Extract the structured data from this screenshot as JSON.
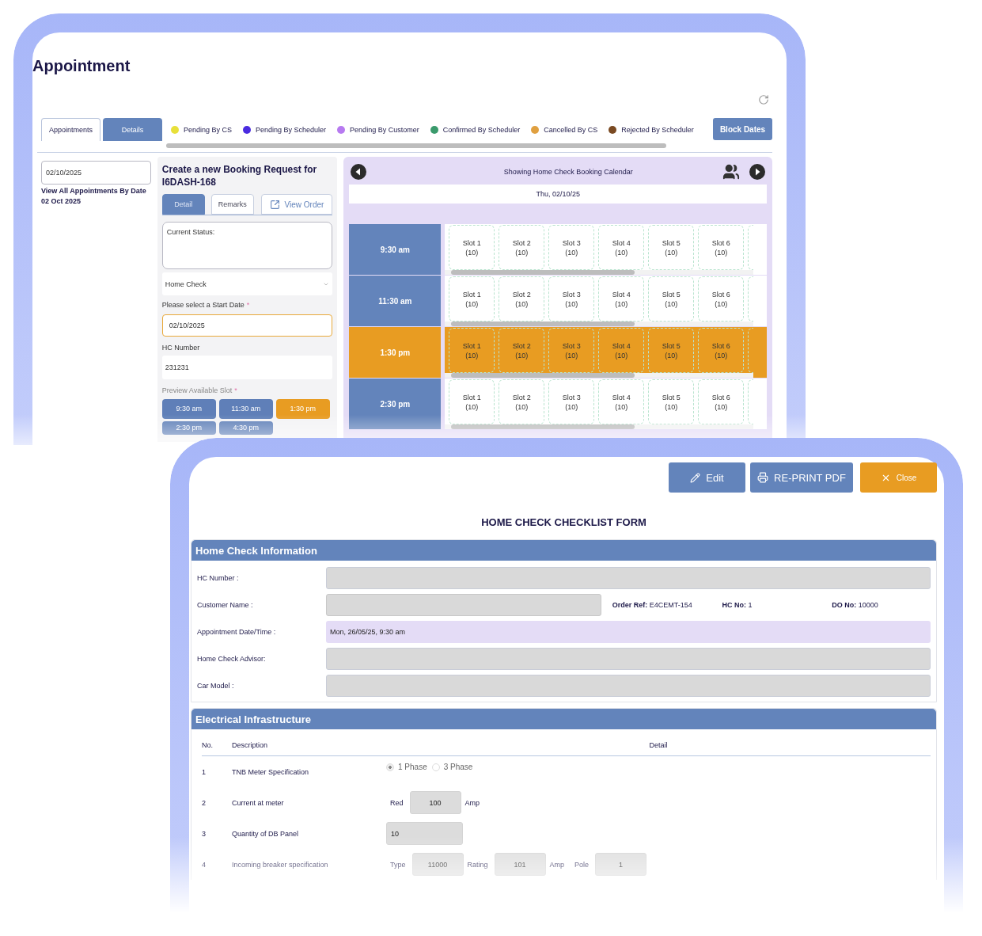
{
  "appointments_window": {
    "title": "Appointment",
    "tabs": [
      {
        "label": "Appointments",
        "selected": true
      },
      {
        "label": "Details",
        "selected": false
      }
    ],
    "legend": [
      {
        "label": "Pending By CS",
        "color": "#e8e03a"
      },
      {
        "label": "Pending By Scheduler",
        "color": "#4a2be0"
      },
      {
        "label": "Pending By Customer",
        "color": "#b77af0"
      },
      {
        "label": "Confirmed By Scheduler",
        "color": "#3a9a6c"
      },
      {
        "label": "Cancelled By CS",
        "color": "#e0a040"
      },
      {
        "label": "Rejected By Scheduler",
        "color": "#7a4a22"
      }
    ],
    "block_button": "Block Dates",
    "date_filter": {
      "value": "02/10/2025",
      "link": "View All Appointments By Date",
      "date": "02 Oct 2025"
    },
    "booking": {
      "heading": "Create a new Booking Request for I6DASH-168",
      "tabs": [
        {
          "label": "Detail",
          "selected": true
        },
        {
          "label": "Remarks",
          "selected": false
        }
      ],
      "view_order": "View Order",
      "status_label": "Current Status:",
      "service": "Home Check",
      "start_date_label": "Please select a Start Date",
      "start_date_mark": "*",
      "start_date": "02/10/2025",
      "hc_label": "HC Number",
      "hc_value": "231231",
      "slot_label": "Preview Available Slot",
      "slot_mark": "*",
      "slots": [
        {
          "label": "9:30 am",
          "selected": false
        },
        {
          "label": "11:30 am",
          "selected": false
        },
        {
          "label": "1:30 pm",
          "selected": true
        },
        {
          "label": "2:30 pm",
          "selected": false
        },
        {
          "label": "4:30 pm",
          "selected": false
        }
      ]
    },
    "calendar": {
      "title": "Showing Home Check Booking Calendar",
      "date": "Thu, 02/10/25",
      "rows": [
        {
          "time": "9:30 am",
          "selected": false,
          "slots": [
            {
              "label": "Slot 1",
              "capacity": "(10)"
            },
            {
              "label": "Slot 2",
              "capacity": "(10)"
            },
            {
              "label": "Slot 3",
              "capacity": "(10)"
            },
            {
              "label": "Slot 4",
              "capacity": "(10)"
            },
            {
              "label": "Slot 5",
              "capacity": "(10)"
            },
            {
              "label": "Slot 6",
              "capacity": "(10)"
            }
          ]
        },
        {
          "time": "11:30 am",
          "selected": false,
          "slots": [
            {
              "label": "Slot 1",
              "capacity": "(10)"
            },
            {
              "label": "Slot 2",
              "capacity": "(10)"
            },
            {
              "label": "Slot 3",
              "capacity": "(10)"
            },
            {
              "label": "Slot 4",
              "capacity": "(10)"
            },
            {
              "label": "Slot 5",
              "capacity": "(10)"
            },
            {
              "label": "Slot 6",
              "capacity": "(10)"
            }
          ]
        },
        {
          "time": "1:30 pm",
          "selected": true,
          "slots": [
            {
              "label": "Slot 1",
              "capacity": "(10)"
            },
            {
              "label": "Slot 2",
              "capacity": "(10)"
            },
            {
              "label": "Slot 3",
              "capacity": "(10)"
            },
            {
              "label": "Slot 4",
              "capacity": "(10)"
            },
            {
              "label": "Slot 5",
              "capacity": "(10)"
            },
            {
              "label": "Slot 6",
              "capacity": "(10)"
            }
          ]
        },
        {
          "time": "2:30 pm",
          "selected": false,
          "slots": [
            {
              "label": "Slot 1",
              "capacity": "(10)"
            },
            {
              "label": "Slot 2",
              "capacity": "(10)"
            },
            {
              "label": "Slot 3",
              "capacity": "(10)"
            },
            {
              "label": "Slot 4",
              "capacity": "(10)"
            },
            {
              "label": "Slot 5",
              "capacity": "(10)"
            },
            {
              "label": "Slot 6",
              "capacity": "(10)"
            }
          ]
        }
      ]
    }
  },
  "checklist_window": {
    "buttons": [
      {
        "label": "Edit",
        "kind": "edit"
      },
      {
        "label": "RE-PRINT PDF",
        "kind": "print"
      },
      {
        "label": "Close",
        "kind": "close"
      }
    ],
    "title": "HOME CHECK CHECKLIST FORM",
    "info": {
      "title": "Home Check Information",
      "fields": [
        {
          "label": "HC Number :",
          "kind": "plain"
        },
        {
          "label": "Customer Name :",
          "kind": "short",
          "meta": [
            {
              "label": "Order Ref:",
              "value": "E4CEMT-154"
            },
            {
              "label": "HC No:",
              "value": "1"
            },
            {
              "label": "DO No:",
              "value": "10000"
            }
          ]
        },
        {
          "label": "Appointment Date/Time :",
          "kind": "highlight",
          "value": "Mon, 26/05/25, 9:30 am"
        },
        {
          "label": "Home Check Advisor:",
          "kind": "plain"
        },
        {
          "label": "Car Model :",
          "kind": "plain"
        }
      ]
    },
    "electrical": {
      "title": "Electrical Infrastructure",
      "columns": [
        "No.",
        "Description",
        "Detail"
      ],
      "rows": [
        {
          "no": "1",
          "description": "TNB Meter Specification",
          "kind": "radio",
          "options": [
            {
              "label": "1 Phase",
              "selected": true
            },
            {
              "label": "3 Phase",
              "selected": false
            }
          ]
        },
        {
          "no": "2",
          "description": "Current at meter",
          "kind": "inputs",
          "parts": [
            {
              "kind": "text",
              "text": "Red"
            },
            {
              "kind": "input",
              "text": "100"
            },
            {
              "kind": "text",
              "text": "Amp"
            }
          ]
        },
        {
          "no": "3",
          "description": "Quantity of DB Panel",
          "kind": "inputs",
          "parts": [
            {
              "kind": "input-wide",
              "text": "10"
            }
          ]
        },
        {
          "no": "4",
          "description": "Incoming breaker specification",
          "kind": "inputs",
          "parts": [
            {
              "kind": "text",
              "text": "Type"
            },
            {
              "kind": "input",
              "text": "11000"
            },
            {
              "kind": "text",
              "text": "Rating"
            },
            {
              "kind": "input",
              "text": "101"
            },
            {
              "kind": "text",
              "text": "Amp"
            },
            {
              "kind": "text",
              "text": "Pole"
            },
            {
              "kind": "input",
              "text": "1"
            }
          ]
        }
      ]
    }
  }
}
